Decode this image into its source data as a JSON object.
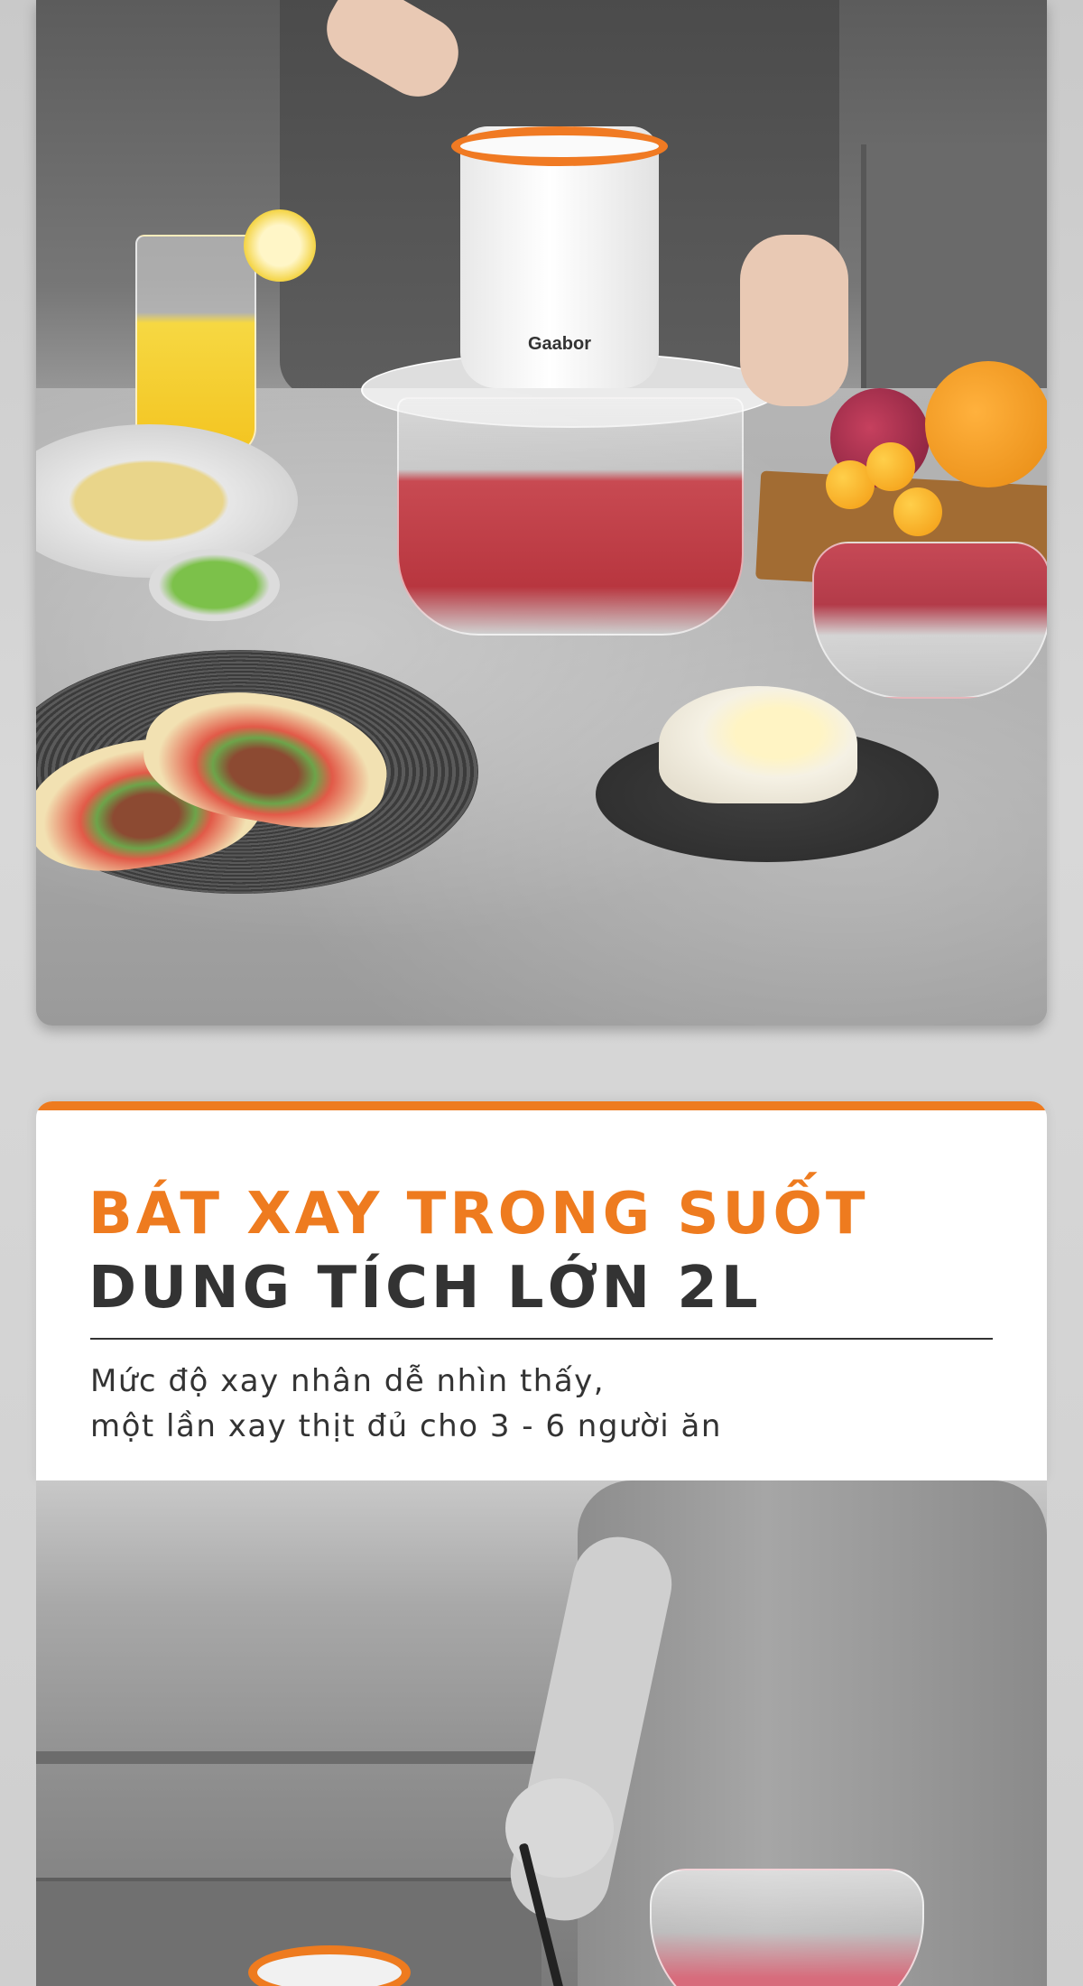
{
  "top_photo": {
    "brand_logo_text": "Gaabor"
  },
  "info": {
    "title_line_1": "BÁT XAY TRONG SUỐT",
    "title_line_2": "DUNG TÍCH LỚN 2L",
    "description_line_1": "Mức độ xay nhân dễ nhìn thấy,",
    "description_line_2": "một lần xay thịt đủ cho 3 - 6 người ăn"
  },
  "colors": {
    "accent": "#ee7b1f",
    "title_dark": "#333333",
    "panel_background": "#ffffff",
    "page_background": "#d0d0d0"
  }
}
